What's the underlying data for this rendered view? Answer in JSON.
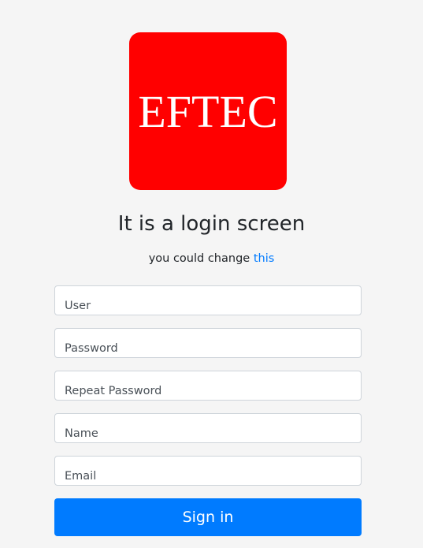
{
  "colors": {
    "logo_bg": "#ff0000",
    "primary": "#007bff",
    "page_bg": "#f5f5f5",
    "link": "#007bff"
  },
  "logo": {
    "text": "EFTEC"
  },
  "header": {
    "title": "It is a login screen",
    "subtitle_prefix": "you could change ",
    "subtitle_link": "this"
  },
  "form": {
    "user_placeholder": "User",
    "password_placeholder": "Password",
    "repeat_password_placeholder": "Repeat Password",
    "name_placeholder": "Name",
    "email_placeholder": "Email",
    "submit_label": "Sign in"
  }
}
